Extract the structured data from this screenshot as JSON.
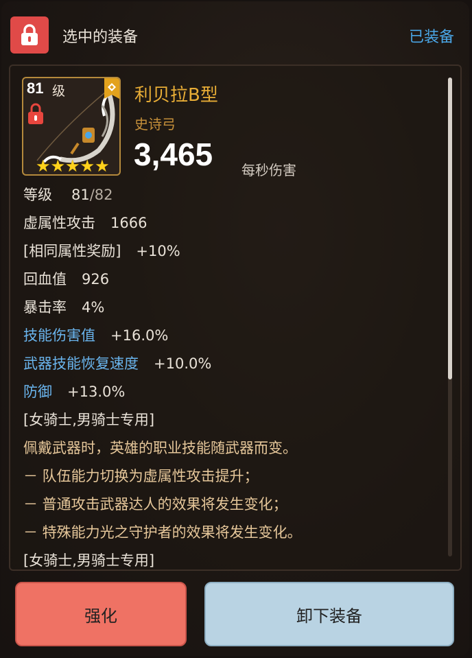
{
  "header": {
    "title": "选中的装备",
    "equipped_label": "已装备"
  },
  "item": {
    "level": "81",
    "level_unit": "级",
    "stars": 5,
    "name": "利贝拉B型",
    "type": "史诗弓",
    "dps_value": "3,465",
    "dps_label": "每秒伤害"
  },
  "stats": {
    "grade": {
      "label": "等级",
      "current": "81",
      "max": "/82"
    },
    "void_attack": {
      "label": "虚属性攻击",
      "value": "1666"
    },
    "same_attr_bonus": {
      "label": "[相同属性奖励]",
      "value": "+10%"
    },
    "hp_regen": {
      "label": "回血值",
      "value": "926"
    },
    "crit_rate": {
      "label": "暴击率",
      "value": "4%"
    },
    "skill_damage": {
      "label": "技能伤害值",
      "value": "+16.0%"
    },
    "weapon_skill_recovery": {
      "label": "武器技能恢复速度",
      "value": "+10.0%"
    },
    "defense": {
      "label": "防御",
      "value": "+13.0%"
    }
  },
  "notes": {
    "restriction_1": "[女骑士,男骑士专用]",
    "desc_1": "佩戴武器时，英雄的职业技能随武器而变。",
    "desc_2": "－ 队伍能力切换为虚属性攻击提升；",
    "desc_3": "－ 普通攻击武器达人的效果将发生变化；",
    "desc_4": "－ 特殊能力光之守护者的效果将发生变化。",
    "restriction_2": "[女骑士,男骑士专用]"
  },
  "buttons": {
    "upgrade": "强化",
    "unequip": "卸下装备"
  },
  "colors": {
    "lock_button": "#e04a48",
    "equipped": "#4aa6e6",
    "item_name": "#e8ad36",
    "blue_stat": "#6ab5ee",
    "upgrade_button": "#ef7264",
    "unequip_button": "#b9d3e3"
  },
  "icons": {
    "lock": "lock-icon",
    "card_lock": "lock-icon",
    "badge": "diamond-badge-icon",
    "weapon": "bow-icon",
    "star": "star-icon"
  }
}
